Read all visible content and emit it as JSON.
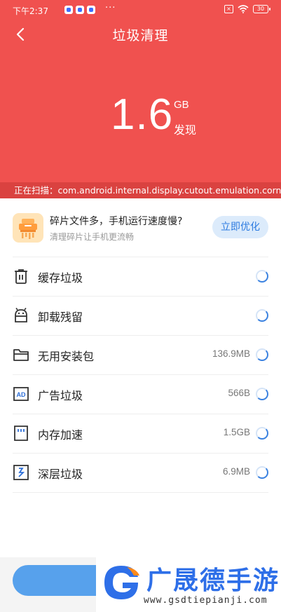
{
  "status_bar": {
    "time": "下午2:37",
    "more": "···",
    "battery": "30"
  },
  "header": {
    "title": "垃圾清理",
    "size_value": "1.6",
    "size_unit": "GB",
    "found_label": "发现",
    "scanning": "正在扫描：com.android.internal.display.cutout.emulation.corner",
    "background_color": "#f0514f"
  },
  "tip": {
    "title": "碎片文件多，手机运行速度慢?",
    "subtitle": "清理碎片让手机更流畅",
    "button": "立即优化"
  },
  "items": [
    {
      "label": "缓存垃圾",
      "size": "",
      "icon": "trash-icon"
    },
    {
      "label": "卸载残留",
      "size": "",
      "icon": "android-icon"
    },
    {
      "label": "无用安装包",
      "size": "136.9MB",
      "icon": "folder-icon"
    },
    {
      "label": "广告垃圾",
      "size": "566B",
      "icon": "ad-icon"
    },
    {
      "label": "内存加速",
      "size": "1.5GB",
      "icon": "memory-icon"
    },
    {
      "label": "深层垃圾",
      "size": "6.9MB",
      "icon": "deep-clean-icon"
    }
  ],
  "watermark": {
    "text": "广晟德手游",
    "url": "www.gsdtiepianji.com"
  }
}
